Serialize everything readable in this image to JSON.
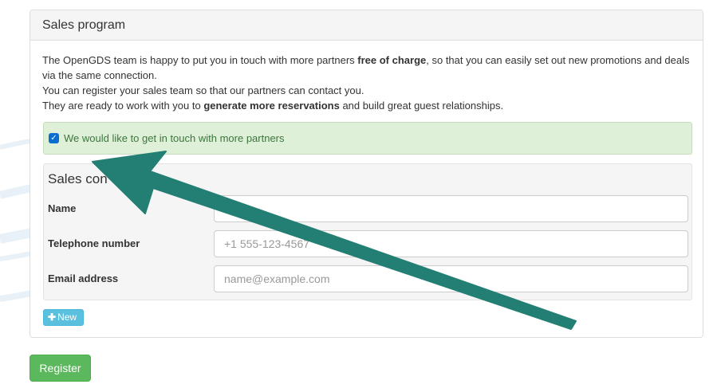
{
  "panel": {
    "title": "Sales program",
    "intro_part1": "The OpenGDS team is happy to put you in touch with more partners ",
    "intro_bold1": "free of charge",
    "intro_part2": ", so that you can easily set out new promotions and deals via the same connection.",
    "intro_line2": "You can register your sales team so that our partners can contact you.",
    "intro_line3_part1": "They are ready to work with you to ",
    "intro_bold2": "generate more reservations",
    "intro_line3_part2": " and build great guest relationships."
  },
  "opt_in": {
    "label": "We would like to get in touch with more partners",
    "checked": true
  },
  "sales_contact": {
    "title": "Sales con",
    "fields": [
      {
        "label": "Name",
        "value": "",
        "placeholder": ""
      },
      {
        "label": "Telephone number",
        "value": "",
        "placeholder": "+1 555-123-4567"
      },
      {
        "label": "Email address",
        "value": "",
        "placeholder": "name@example.com"
      }
    ]
  },
  "buttons": {
    "new_label": "New",
    "register_label": "Register"
  },
  "colors": {
    "annotation_arrow": "#237f73",
    "success_button": "#5cb85c",
    "info_button": "#5bc0de",
    "checkbox_alert_bg": "#dff0d8"
  }
}
